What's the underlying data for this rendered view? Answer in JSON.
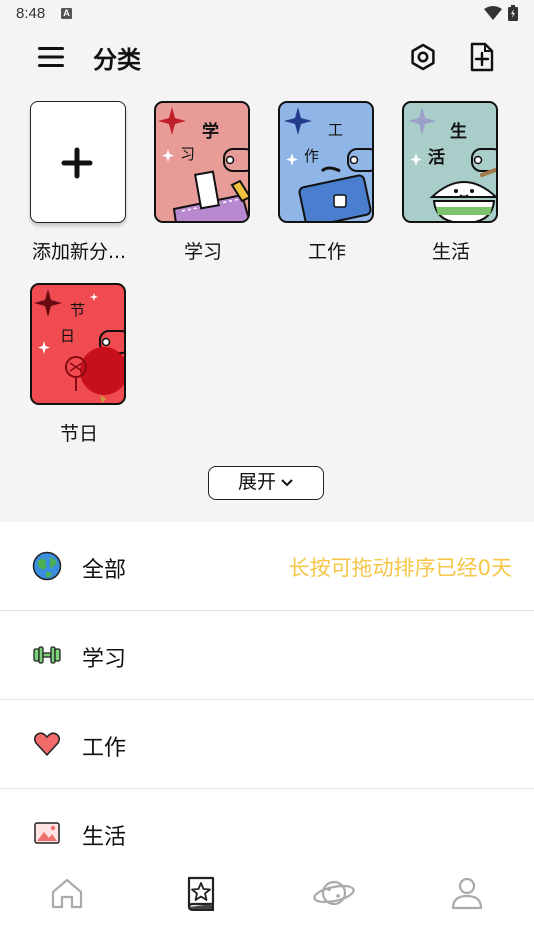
{
  "status_bar": {
    "time": "8:48",
    "notification_badge": "A"
  },
  "header": {
    "title": "分类"
  },
  "categories": [
    {
      "label": "添加新分...",
      "type": "add"
    },
    {
      "label": "学习",
      "title_chars": [
        "学",
        "习"
      ],
      "color": "#e89c97"
    },
    {
      "label": "工作",
      "title_chars": [
        "工",
        "作"
      ],
      "color": "#8fb6e6"
    },
    {
      "label": "生活",
      "title_chars": [
        "生",
        "活"
      ],
      "color": "#a9cec9"
    },
    {
      "label": "节日",
      "title_chars": [
        "节",
        "日"
      ],
      "color": "#f04b50"
    }
  ],
  "expand": {
    "label": "展开"
  },
  "list": [
    {
      "label": "全部",
      "icon": "globe-icon",
      "hint": "长按可拖动排序已经0天"
    },
    {
      "label": "学习",
      "icon": "dumbbell-icon"
    },
    {
      "label": "工作",
      "icon": "heart-icon"
    },
    {
      "label": "生活",
      "icon": "picture-icon"
    }
  ],
  "tab_bar": {
    "tabs": [
      "home-icon",
      "book-star-icon",
      "planet-icon",
      "profile-icon"
    ],
    "active_index": 1
  },
  "colors": {
    "hint": "#f5c648",
    "panel_bg": "#f4f4f4",
    "active_tab": "#222222",
    "inactive_tab": "#aaaaaa"
  }
}
